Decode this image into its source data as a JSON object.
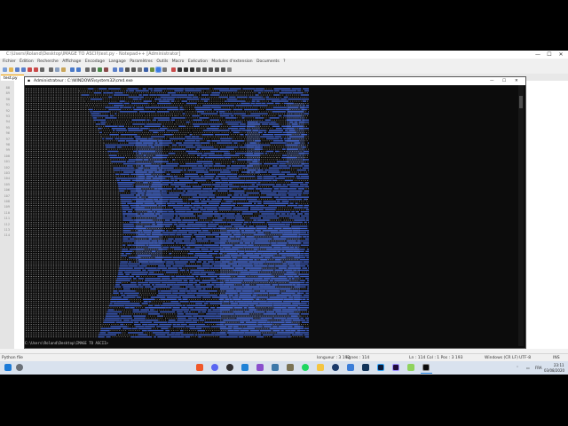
{
  "window": {
    "title": "C:\\Users\\Roland\\Desktop\\IMAGE TO ASCII\\test.py - Notepad++ [Administrator]",
    "controls": [
      "—",
      "☐",
      "✕"
    ]
  },
  "menu": [
    "Fichier",
    "Édition",
    "Recherche",
    "Affichage",
    "Encodage",
    "Langage",
    "Paramètres",
    "Outils",
    "Macro",
    "Exécution",
    "Modules d'extension",
    "Documents",
    "?"
  ],
  "tab": {
    "label": "test.py"
  },
  "line_numbers": [
    "88",
    "89",
    "90",
    "91",
    "92",
    "93",
    "94",
    "95",
    "96",
    "97",
    "98",
    "99",
    "100",
    "101",
    "102",
    "103",
    "104",
    "105",
    "106",
    "107",
    "108",
    "109",
    "110",
    "111",
    "112",
    "113",
    "114"
  ],
  "cmd": {
    "title": "Administrateur : C:\\WINDOWS\\system32\\cmd.exe",
    "prompt": "C:\\Users\\Roland\\Desktop\\IMAGE TO ASCII>",
    "controls": [
      "—",
      "☐",
      "✕"
    ]
  },
  "status": {
    "left": "Python file",
    "length": "longueur : 3 192",
    "lines": "lignes : 114",
    "position": "Ln : 114   Col : 1   Pos : 3 193",
    "eol": "Windows (CR LF)",
    "encoding": "UTF-8",
    "ins": "INS"
  },
  "taskbar": {
    "lang": "FRA",
    "time": "23:11",
    "date": "03/08/2020",
    "apps": [
      "start-icon",
      "search-icon",
      "brave-icon",
      "discord-icon",
      "obs-icon",
      "vscode-icon",
      "visual-studio-icon",
      "python-icon",
      "gimp-icon",
      "spotify-icon",
      "explorer-icon",
      "steam-icon",
      "edit-icon",
      "powershell-icon",
      "photoshop-icon",
      "premiere-icon",
      "notepadpp-icon",
      "cmd-icon"
    ]
  },
  "colors": {
    "ascii_blue": "#3e5fc4",
    "ascii_gray": "#8c8c8c",
    "cmd_bg": "#0c0c0c",
    "accent": "#f0a000"
  }
}
